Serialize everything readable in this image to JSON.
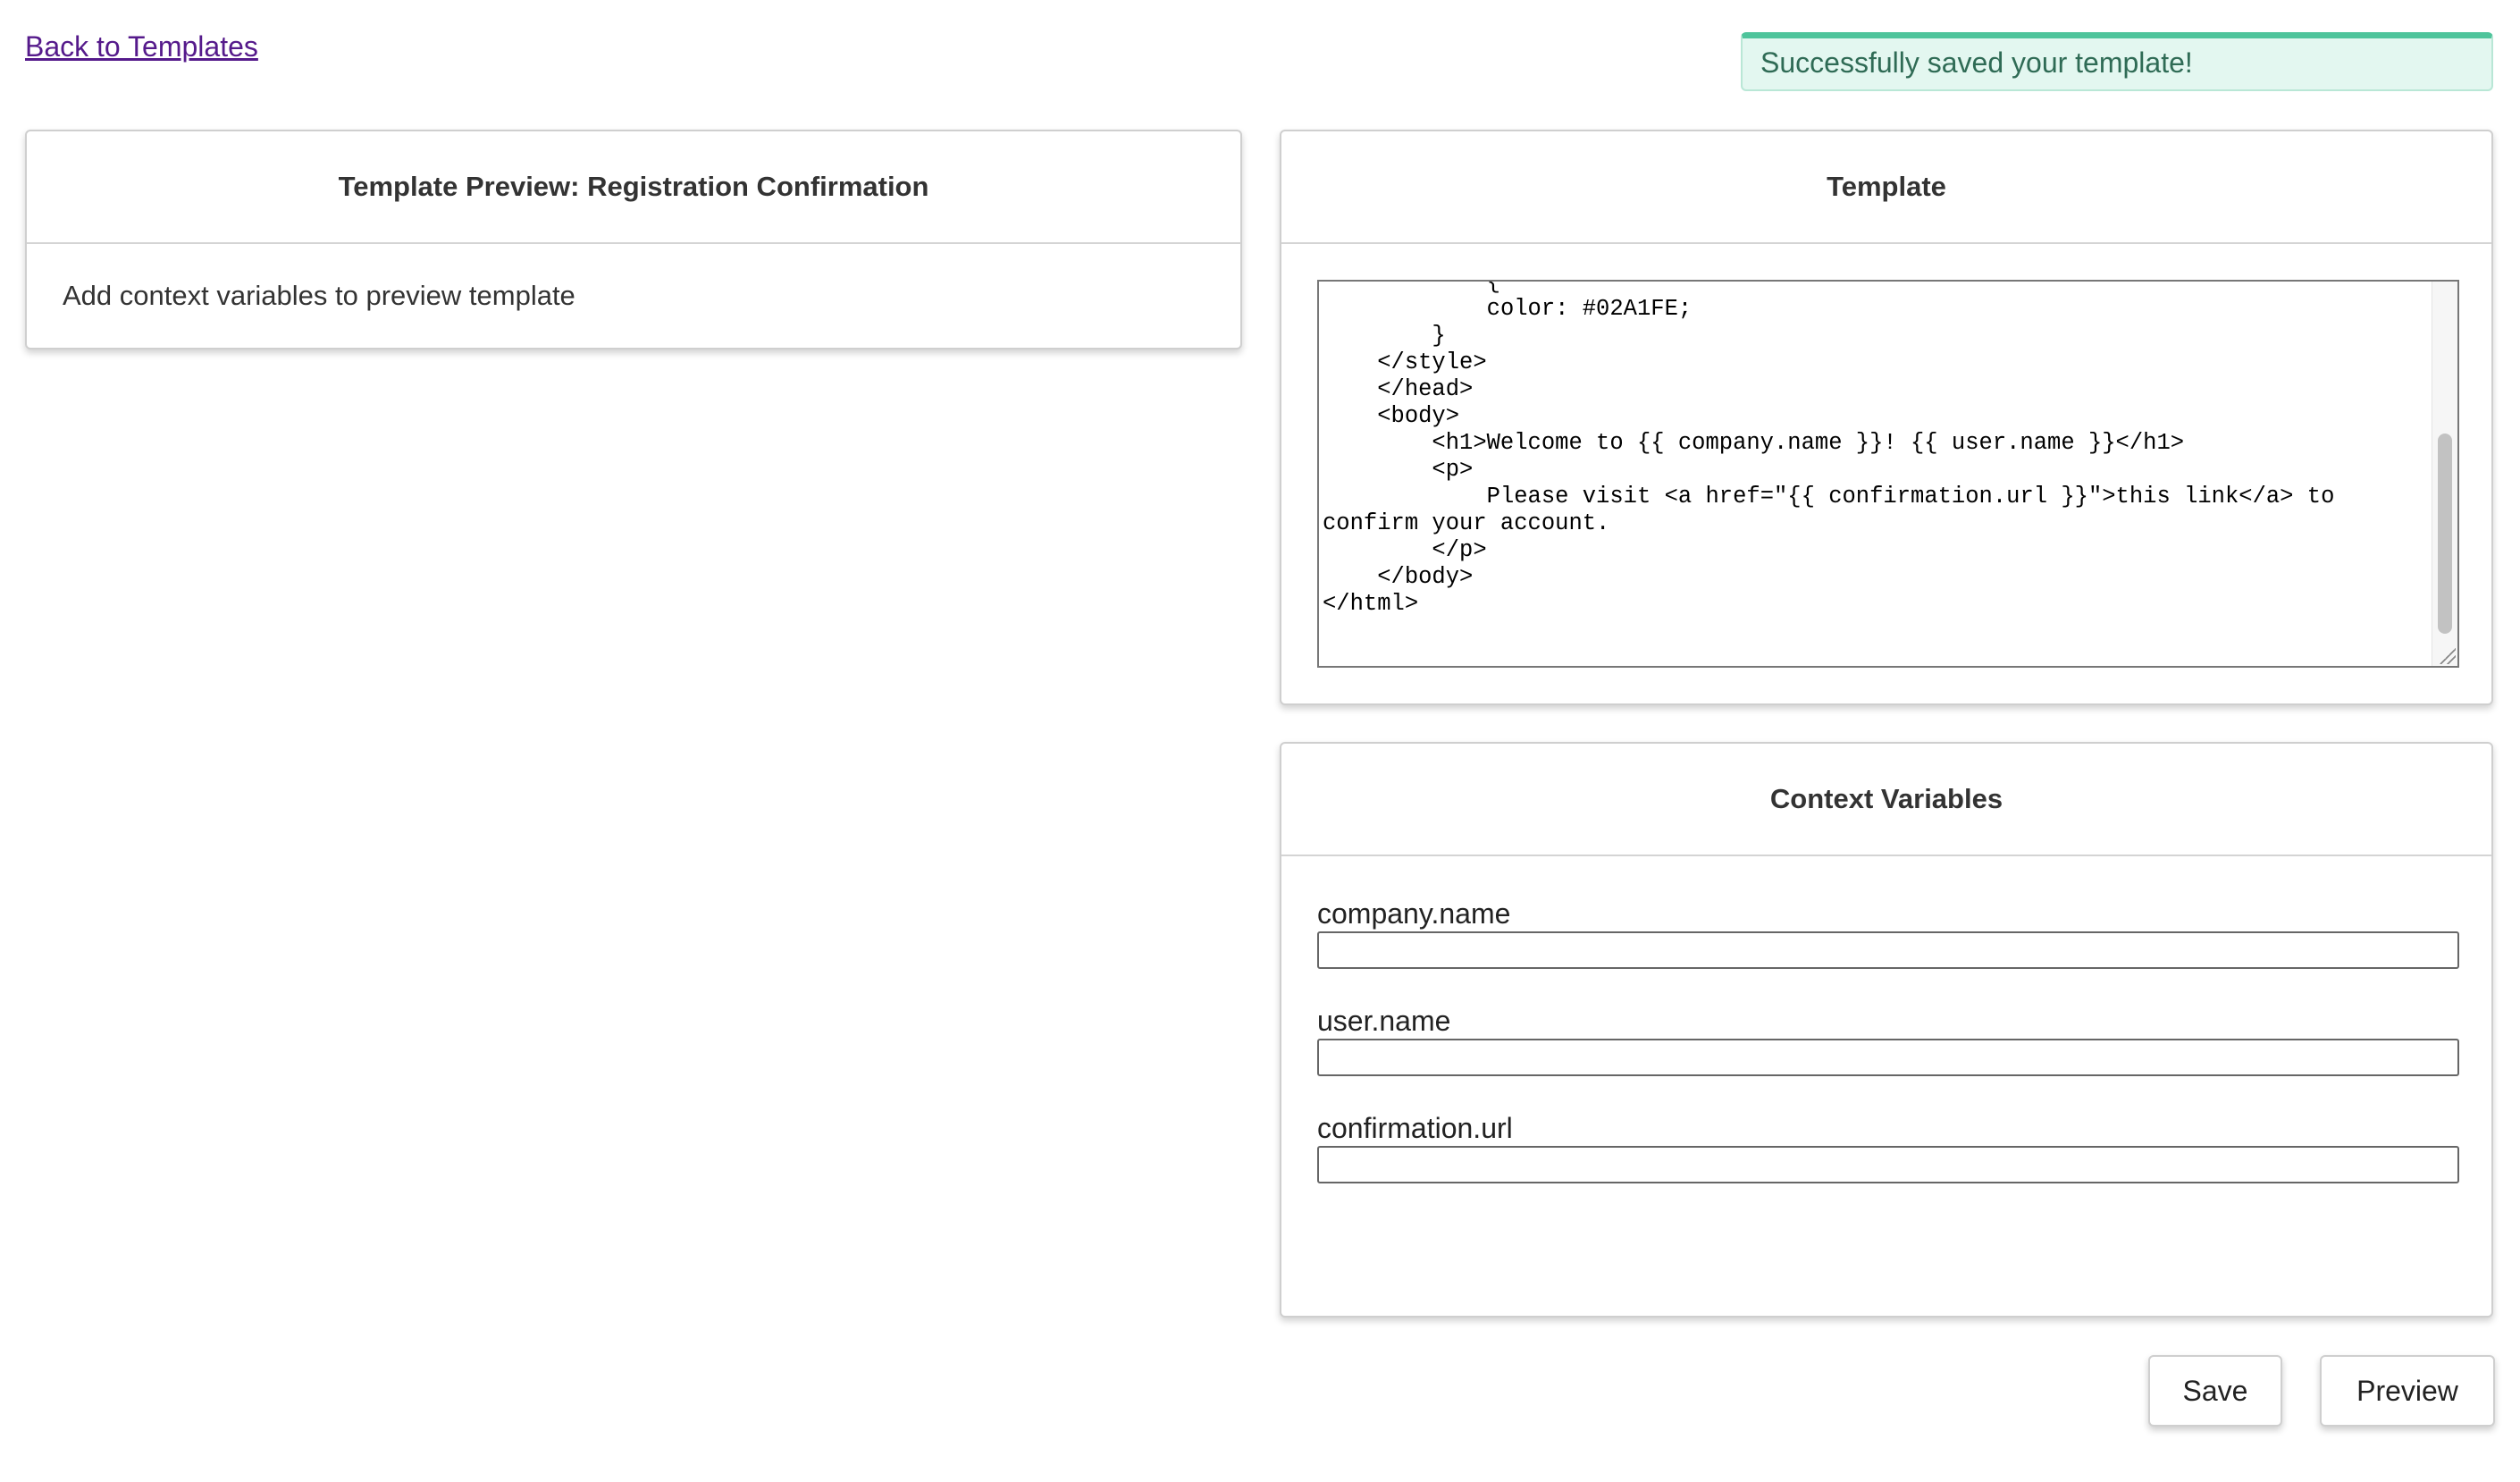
{
  "nav": {
    "back_link": "Back to Templates"
  },
  "toast": {
    "message": "Successfully saved your template!"
  },
  "preview": {
    "title": "Template Preview: Registration Confirmation",
    "message": "Add context variables to preview template"
  },
  "template": {
    "title": "Template",
    "code": "            {\n            color: #02A1FE;\n        }\n    </style>\n    </head>\n    <body>\n        <h1>Welcome to {{ company.name }}! {{ user.name }}</h1>\n        <p>\n            Please visit <a href=\"{{ confirmation.url }}\">this link</a> to confirm your account.\n        </p>\n    </body>\n</html>"
  },
  "context": {
    "title": "Context Variables",
    "fields": [
      {
        "label": "company.name",
        "value": ""
      },
      {
        "label": "user.name",
        "value": ""
      },
      {
        "label": "confirmation.url",
        "value": ""
      }
    ]
  },
  "actions": {
    "save_label": "Save",
    "preview_label": "Preview"
  },
  "colors": {
    "toast_accent": "#4ec49b",
    "toast_background": "#e3f7f0",
    "link": "#551a8b"
  }
}
